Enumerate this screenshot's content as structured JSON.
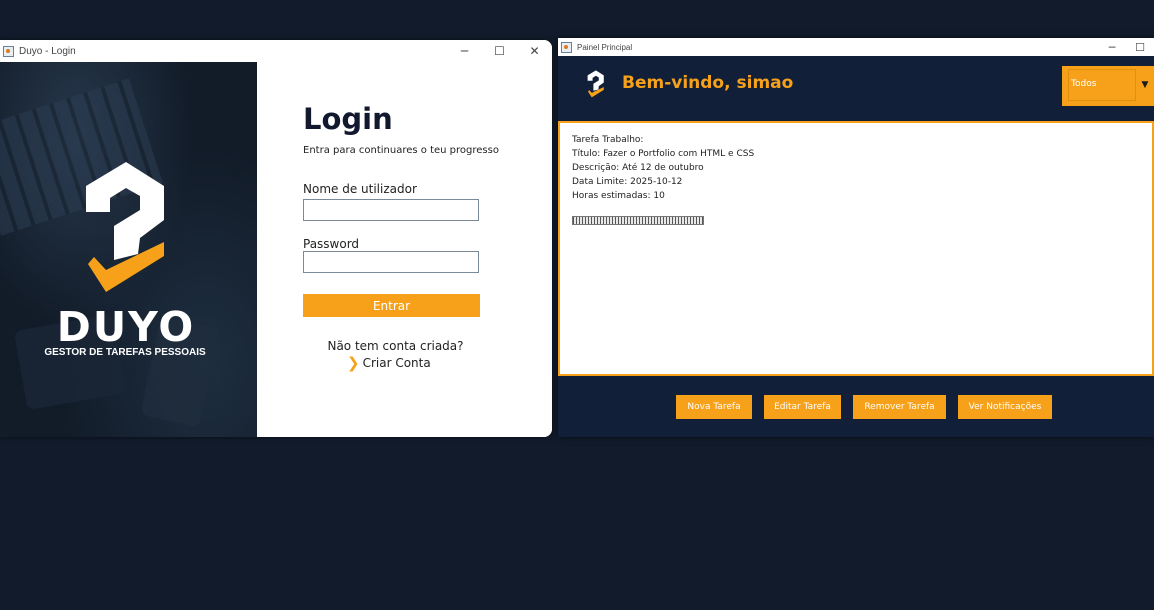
{
  "login_window": {
    "title": "Duyo - Login",
    "controls": {
      "minimize": "─",
      "maximize": "☐",
      "close": "✕"
    },
    "brand": {
      "name": "DUYO",
      "tagline": "GESTOR DE TAREFAS PESSOAIS"
    },
    "heading": "Login",
    "subheading": "Entra para continuares o teu progresso",
    "username": {
      "label": "Nome de utilizador",
      "value": "",
      "placeholder": ""
    },
    "password": {
      "label": "Password",
      "value": "",
      "placeholder": ""
    },
    "submit_label": "Entrar",
    "no_account_text": "Não tem conta criada?",
    "create_account_label": "Criar Conta",
    "create_account_chevron": "❯"
  },
  "panel_window": {
    "title": "Painel Principal",
    "controls": {
      "minimize": "─",
      "maximize": "☐"
    },
    "welcome": "Bem-vindo, simao",
    "filter": {
      "selected": "Todos",
      "arrow": "▼"
    },
    "task": {
      "type": "Tarefa Trabalho:",
      "title": "Título: Fazer o Portfolio com HTML e CSS",
      "description": "Descrição: Até 12 de outubro",
      "deadline": "Data Limite: 2025-10-12",
      "hours": "Horas estimadas: 10"
    },
    "buttons": {
      "new": "Nova Tarefa",
      "edit": "Editar Tarefa",
      "remove": "Remover Tarefa",
      "notifications": "Ver Notificações"
    }
  },
  "colors": {
    "accent": "#f7a11a",
    "navy": "#111f38",
    "desktop": "#111b2b",
    "login_text": "#12192e"
  },
  "icons": {
    "app": "java-app-icon",
    "logo": "duyo-logo-icon"
  }
}
